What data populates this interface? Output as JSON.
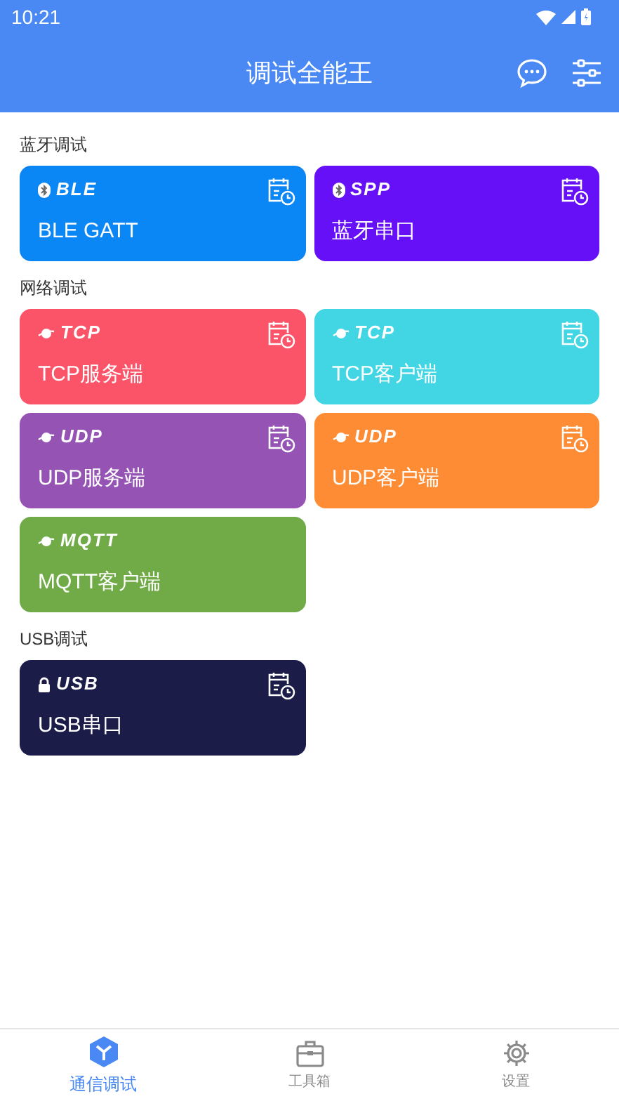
{
  "status_bar": {
    "time": "10:21"
  },
  "app_bar": {
    "title": "调试全能王"
  },
  "sections": [
    {
      "title": "蓝牙调试",
      "cards": [
        {
          "badge": "BLE",
          "label": "BLE GATT",
          "kind": "bluetooth",
          "color": "#0a86f5",
          "history": true
        },
        {
          "badge": "SPP",
          "label": "蓝牙串口",
          "kind": "bluetooth",
          "color": "#6610f7",
          "history": true
        }
      ]
    },
    {
      "title": "网络调试",
      "cards": [
        {
          "badge": "TCP",
          "label": "TCP服务端",
          "kind": "network",
          "color": "#fb5368",
          "history": true
        },
        {
          "badge": "TCP",
          "label": "TCP客户端",
          "kind": "network",
          "color": "#42d6e4",
          "history": true
        },
        {
          "badge": "UDP",
          "label": "UDP服务端",
          "kind": "network",
          "color": "#9554b4",
          "history": true
        },
        {
          "badge": "UDP",
          "label": "UDP客户端",
          "kind": "network",
          "color": "#fd8c34",
          "history": true
        },
        {
          "badge": "MQTT",
          "label": "MQTT客户端",
          "kind": "network",
          "color": "#70ab47",
          "history": false
        }
      ]
    },
    {
      "title": "USB调试",
      "cards": [
        {
          "badge": "USB",
          "label": "USB串口",
          "kind": "usb",
          "color": "#1c1c48",
          "history": true
        }
      ]
    }
  ],
  "bottom_nav": [
    {
      "label": "通信调试",
      "kind": "cube",
      "selected": true
    },
    {
      "label": "工具箱",
      "kind": "toolbox",
      "selected": false
    },
    {
      "label": "设置",
      "kind": "gear",
      "selected": false
    }
  ]
}
